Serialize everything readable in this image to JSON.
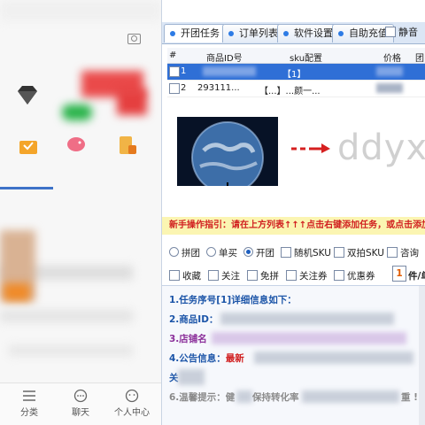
{
  "tabs": [
    {
      "label": "开团任务"
    },
    {
      "label": "订单列表"
    },
    {
      "label": "软件设置"
    },
    {
      "label": "自助充值"
    }
  ],
  "mute_label": "静音",
  "grid": {
    "columns": [
      "#",
      "商品ID号",
      "sku配置",
      "价格",
      "团"
    ],
    "rows": [
      {
        "index": "1",
        "product_id": "",
        "sku": "【1】",
        "price": ""
      },
      {
        "index": "2",
        "product_id": "293111...",
        "sku": "【...】...颜一...",
        "price": ""
      }
    ]
  },
  "watermark": "ddyxy",
  "notice": "新手操作指引：请在上方列表↑↑↑点击右键添加任务，或点击添加任",
  "options": {
    "row1": [
      {
        "label": "拼团",
        "kind": "radio",
        "checked": false
      },
      {
        "label": "单买",
        "kind": "radio",
        "checked": false
      },
      {
        "label": "开团",
        "kind": "radio",
        "checked": true
      },
      {
        "label": "随机SKU",
        "kind": "checkbox",
        "checked": false
      },
      {
        "label": "双拍SKU",
        "kind": "checkbox",
        "checked": false
      },
      {
        "label": "咨询",
        "kind": "checkbox",
        "checked": false
      }
    ],
    "row2": [
      {
        "label": "收藏",
        "kind": "checkbox"
      },
      {
        "label": "关注",
        "kind": "checkbox"
      },
      {
        "label": "免拼",
        "kind": "checkbox"
      },
      {
        "label": "关注券",
        "kind": "checkbox"
      },
      {
        "label": "优惠券",
        "kind": "checkbox"
      }
    ],
    "qty_value": "1",
    "qty_unit": "件/单"
  },
  "detail": {
    "line1": "1.任务序号[1]详细信息如下：",
    "line2": "2.商品ID：",
    "line3": "3.店铺名",
    "line4": "4.公告信息：",
    "line4b": "最新",
    "line5": "关",
    "line6": "6.温馨提示：健",
    "line6b": "保持转化率",
    "line6c": "重 !"
  },
  "left_nav": [
    {
      "label": "分类"
    },
    {
      "label": "聊天"
    },
    {
      "label": "个人中心"
    }
  ],
  "colors": {
    "accent": "#2f6fd6",
    "notice_bg": "#fbf5b2",
    "notice_text": "#d12020"
  }
}
